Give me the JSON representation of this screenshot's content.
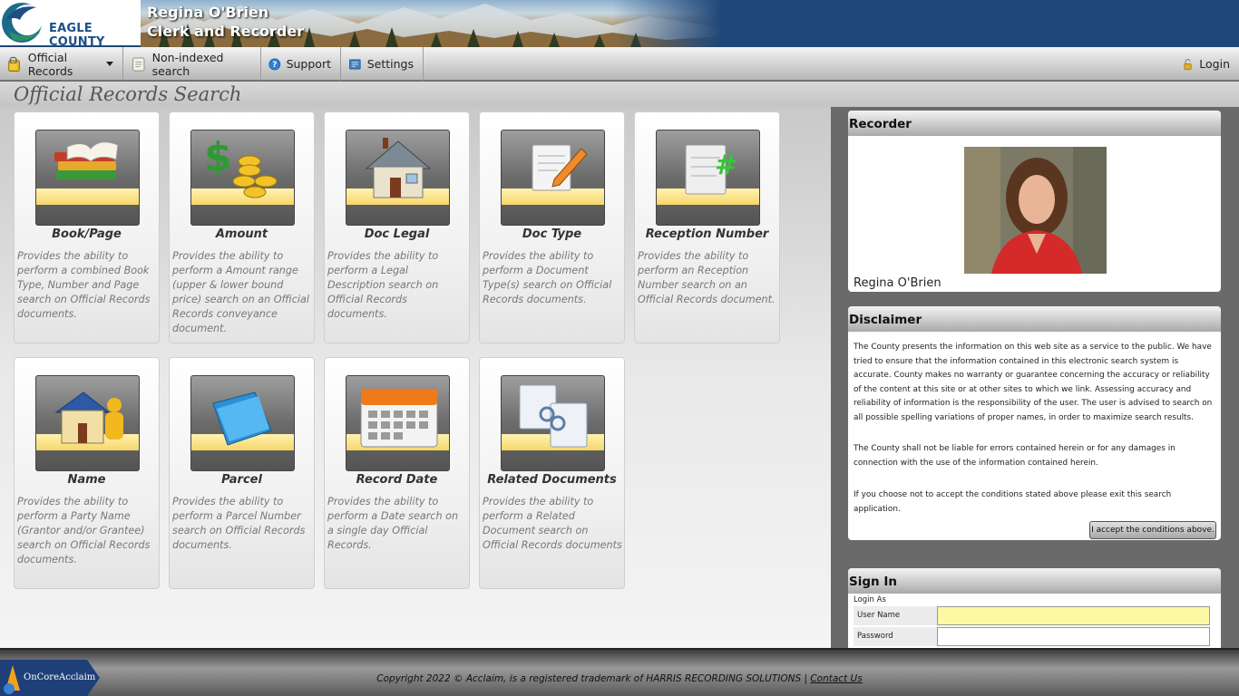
{
  "header": {
    "logo_text": "EAGLE COUNTY",
    "title_line1": "Regina O'Brien",
    "title_line2": "Clerk and Recorder"
  },
  "nav": {
    "items": [
      {
        "label": "Official Records",
        "icon": "folder-lock-icon",
        "dropdown": true
      },
      {
        "label": "Non-indexed search",
        "icon": "scroll-icon"
      },
      {
        "label": "Support",
        "icon": "help-icon"
      },
      {
        "label": "Settings",
        "icon": "settings-icon"
      }
    ],
    "login_label": "Login"
  },
  "page_title": "Official Records Search",
  "tiles": [
    {
      "title": "Book/Page",
      "icon": "books-icon",
      "desc": "Provides the ability to perform a combined Book Type, Number and Page search on Official Records documents."
    },
    {
      "title": "Amount",
      "icon": "dollar-coins-icon",
      "desc": "Provides the ability to perform a Amount range (upper & lower bound price) search on an Official Records conveyance document."
    },
    {
      "title": "Doc Legal",
      "icon": "house-icon",
      "desc": "Provides the ability to perform a Legal Description search on Official Records documents."
    },
    {
      "title": "Doc Type",
      "icon": "document-pencil-icon",
      "desc": "Provides the ability to perform a Document Type(s) search on Official Records documents."
    },
    {
      "title": "Reception Number",
      "icon": "document-hash-icon",
      "desc": "Provides the ability to perform an Reception Number search on an Official Records document."
    },
    {
      "title": "Name",
      "icon": "house-person-icon",
      "desc": "Provides the ability to perform a Party Name (Grantor and/or Grantee) search on Official Records documents."
    },
    {
      "title": "Parcel",
      "icon": "folder-icon",
      "desc": "Provides the ability to perform a Parcel Number search on Official Records documents."
    },
    {
      "title": "Record Date",
      "icon": "calendar-icon",
      "desc": "Provides the ability to perform a Date search on a single day Official Records."
    },
    {
      "title": "Related Documents",
      "icon": "linked-documents-icon",
      "desc": "Provides the ability to perform a Related Document search on Official Records documents"
    }
  ],
  "recorder": {
    "heading": "Recorder",
    "name": "Regina O'Brien"
  },
  "disclaimer": {
    "heading": "Disclaimer",
    "para1": "The County presents the information on this web site as a service to the public. We have tried to ensure that the information contained in this electronic search system is accurate. County makes no warranty or guarantee concerning the accuracy or reliability of the content at this site or at other sites to which we link. Assessing accuracy and reliability of information is the responsibility of the user. The user is advised to search on all possible spelling variations of proper names, in order to maximize search results.",
    "para2": "The County shall not be liable for errors contained herein or for any damages in connection with the use of the information contained herein.",
    "para3": "If you choose not to accept the conditions stated above please exit this search application.",
    "accept_label": "I accept the conditions above."
  },
  "signin": {
    "heading": "Sign In",
    "login_as": "Login As",
    "username_label": "User Name",
    "username_value": "",
    "password_label": "Password",
    "password_value": ""
  },
  "footer": {
    "logo_text": "OnCoreAcclaim",
    "copyright": "Copyright 2022 © Acclaim, is a registered trademark of HARRIS RECORDING SOLUTIONS | ",
    "contact_label": "Contact Us"
  },
  "colors": {
    "header_blue": "#1f4778",
    "accent_yellow": "#f7d66b",
    "input_highlight": "#fbf9a3"
  }
}
